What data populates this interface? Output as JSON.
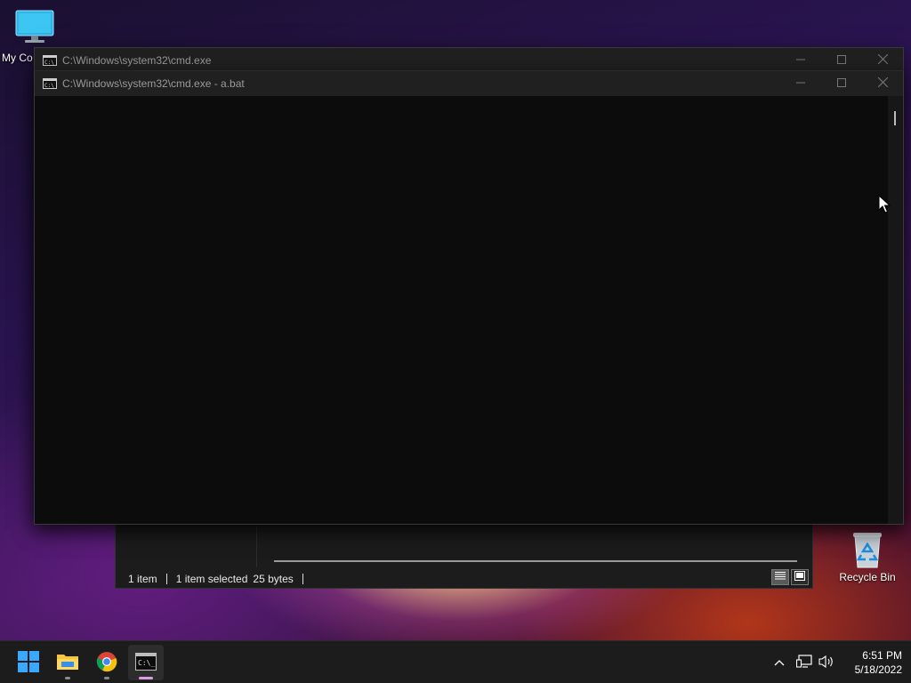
{
  "desktop": {
    "icons": [
      {
        "label": "My Co"
      },
      {
        "label": "Recycle Bin"
      }
    ]
  },
  "windows": {
    "cmd_back": {
      "title": "C:\\Windows\\system32\\cmd.exe"
    },
    "cmd_front": {
      "title": "C:\\Windows\\system32\\cmd.exe - a.bat"
    }
  },
  "explorer": {
    "status": {
      "item_count": "1 item",
      "selected": "1 item selected",
      "size": "25 bytes"
    }
  },
  "taskbar": {
    "apps": [
      "start-icon",
      "file-explorer-icon",
      "chrome-icon",
      "cmd-icon"
    ],
    "clock": {
      "time": "6:51 PM",
      "date": "5/18/2022"
    }
  },
  "colors": {
    "titlebar": "#202020",
    "console_bg": "#0c0c0c",
    "taskbar": "#1c1c1c",
    "active_indicator": "#d9a0e0"
  }
}
